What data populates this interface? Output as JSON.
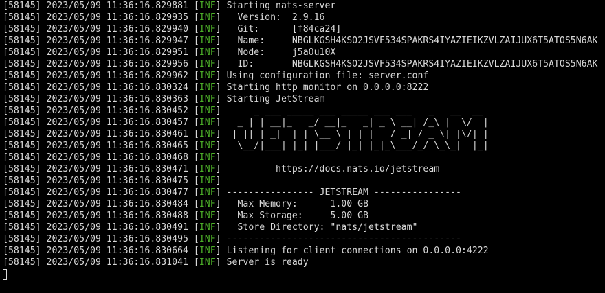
{
  "colors": {
    "background": "#000000",
    "text": "#d8d8d8",
    "level": "#4caf28"
  },
  "log": {
    "lines": [
      {
        "prefix": "[58145] 2023/05/09 11:36:16.829881 ",
        "level": "INF",
        "message": "Starting nats-server"
      },
      {
        "prefix": "[58145] 2023/05/09 11:36:16.829935 ",
        "level": "INF",
        "message": "  Version:  2.9.16"
      },
      {
        "prefix": "[58145] 2023/05/09 11:36:16.829940 ",
        "level": "INF",
        "message": "  Git:      [f84ca24]"
      },
      {
        "prefix": "[58145] 2023/05/09 11:36:16.829947 ",
        "level": "INF",
        "message": "  Name:     NBGLKGSH4KSO2JSVF534SPAKRS4IYAZIEIKZVLZAIJUX6T5ATOS5N6AK"
      },
      {
        "prefix": "[58145] 2023/05/09 11:36:16.829951 ",
        "level": "INF",
        "message": "  Node:     j5aOu10X"
      },
      {
        "prefix": "[58145] 2023/05/09 11:36:16.829956 ",
        "level": "INF",
        "message": "  ID:       NBGLKGSH4KSO2JSVF534SPAKRS4IYAZIEIKZVLZAIJUX6T5ATOS5N6AK"
      },
      {
        "prefix": "[58145] 2023/05/09 11:36:16.829962 ",
        "level": "INF",
        "message": "Using configuration file: server.conf"
      },
      {
        "prefix": "[58145] 2023/05/09 11:36:16.830324 ",
        "level": "INF",
        "message": "Starting http monitor on 0.0.0.0:8222"
      },
      {
        "prefix": "[58145] 2023/05/09 11:36:16.830363 ",
        "level": "INF",
        "message": "Starting JetStream"
      },
      {
        "prefix": "[58145] 2023/05/09 11:36:16.830452 ",
        "level": "INF",
        "message": "     _ ___ _____ ___ _____ ___ ___   _   __  __"
      },
      {
        "prefix": "[58145] 2023/05/09 11:36:16.830457 ",
        "level": "INF",
        "message": "  _ | | __|_   _/ __|_   _| _ \\ __| /_\\ |  \\/  |"
      },
      {
        "prefix": "[58145] 2023/05/09 11:36:16.830461 ",
        "level": "INF",
        "message": " | || | _|  | | \\__ \\ | | |   / _| / _ \\| |\\/| |"
      },
      {
        "prefix": "[58145] 2023/05/09 11:36:16.830465 ",
        "level": "INF",
        "message": "  \\__/|___| |_| |___/ |_| |_|_\\___/_/ \\_\\_|  |_|"
      },
      {
        "prefix": "[58145] 2023/05/09 11:36:16.830468 ",
        "level": "INF",
        "message": ""
      },
      {
        "prefix": "[58145] 2023/05/09 11:36:16.830471 ",
        "level": "INF",
        "message": "         https://docs.nats.io/jetstream"
      },
      {
        "prefix": "[58145] 2023/05/09 11:36:16.830475 ",
        "level": "INF",
        "message": ""
      },
      {
        "prefix": "[58145] 2023/05/09 11:36:16.830477 ",
        "level": "INF",
        "message": "---------------- JETSTREAM ----------------"
      },
      {
        "prefix": "[58145] 2023/05/09 11:36:16.830484 ",
        "level": "INF",
        "message": "  Max Memory:      1.00 GB"
      },
      {
        "prefix": "[58145] 2023/05/09 11:36:16.830488 ",
        "level": "INF",
        "message": "  Max Storage:     5.00 GB"
      },
      {
        "prefix": "[58145] 2023/05/09 11:36:16.830491 ",
        "level": "INF",
        "message": "  Store Directory: \"nats/jetstream\""
      },
      {
        "prefix": "[58145] 2023/05/09 11:36:16.830495 ",
        "level": "INF",
        "message": "-------------------------------------------"
      },
      {
        "prefix": "[58145] 2023/05/09 11:36:16.830664 ",
        "level": "INF",
        "message": "Listening for client connections on 0.0.0.0:4222"
      },
      {
        "prefix": "[58145] 2023/05/09 11:36:16.831041 ",
        "level": "INF",
        "message": "Server is ready"
      }
    ]
  }
}
